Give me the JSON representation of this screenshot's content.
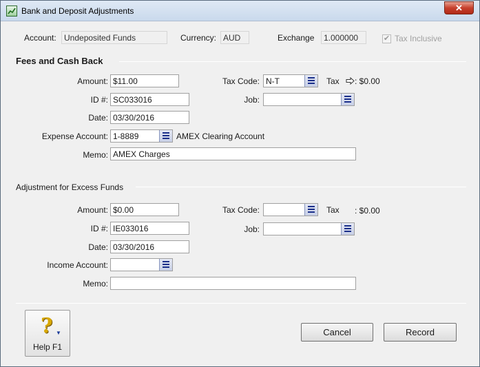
{
  "window": {
    "title": "Bank and Deposit Adjustments",
    "close_label": "✕"
  },
  "header": {
    "account_label": "Account:",
    "account_value": "Undeposited Funds",
    "currency_label": "Currency:",
    "currency_value": "AUD",
    "exchange_label": "Exchange",
    "exchange_value": "1.000000",
    "tax_inclusive_label": "Tax Inclusive",
    "tax_inclusive_checked": true
  },
  "fees": {
    "title": "Fees and Cash Back",
    "amount_label": "Amount:",
    "amount_value": "$11.00",
    "tax_code_label": "Tax Code:",
    "tax_code_value": "N-T",
    "tax_label": "Tax",
    "tax_value": ": $0.00",
    "id_label": "ID #:",
    "id_value": "SC033016",
    "job_label": "Job:",
    "job_value": "",
    "date_label": "Date:",
    "date_value": "03/30/2016",
    "expense_account_label": "Expense Account:",
    "expense_account_value": "1-8889",
    "expense_account_name": "AMEX Clearing Account",
    "memo_label": "Memo:",
    "memo_value": "AMEX Charges"
  },
  "excess": {
    "title": "Adjustment for Excess Funds",
    "amount_label": "Amount:",
    "amount_value": "$0.00",
    "tax_code_label": "Tax Code:",
    "tax_code_value": "",
    "tax_label": "Tax",
    "tax_value": ": $0.00",
    "id_label": "ID #:",
    "id_value": "IE033016",
    "job_label": "Job:",
    "job_value": "",
    "date_label": "Date:",
    "date_value": "03/30/2016",
    "income_account_label": "Income Account:",
    "income_account_value": "",
    "memo_label": "Memo:",
    "memo_value": ""
  },
  "footer": {
    "help_label": "Help F1",
    "cancel_label": "Cancel",
    "record_label": "Record"
  },
  "colors": {
    "titlebar": "#c9d9ec",
    "close_button": "#c7402d",
    "combo_button": "#c7cfe6"
  }
}
